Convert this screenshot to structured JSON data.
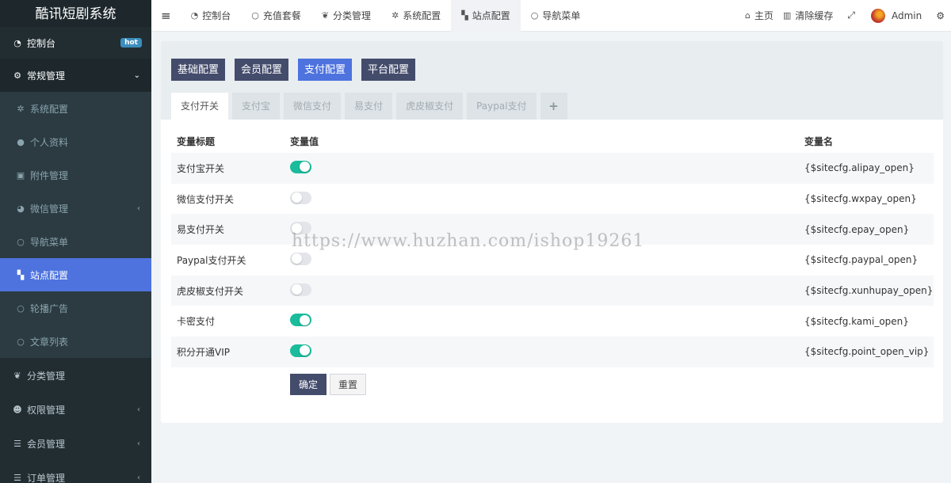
{
  "app": {
    "title": "酷讯短剧系统"
  },
  "sidebar": {
    "dashboard": {
      "label": "控制台",
      "badge": "hot"
    },
    "group_regular": {
      "label": "常规管理"
    },
    "sub_items": [
      {
        "label": "系统配置",
        "icon": "gear-icon"
      },
      {
        "label": "个人资料",
        "icon": "user-icon"
      },
      {
        "label": "附件管理",
        "icon": "file-image-icon"
      },
      {
        "label": "微信管理",
        "icon": "wechat-icon"
      },
      {
        "label": "导航菜单",
        "icon": "circle-icon"
      },
      {
        "label": "站点配置",
        "icon": "qrcode-icon"
      },
      {
        "label": "轮播广告",
        "icon": "circle-icon"
      },
      {
        "label": "文章列表",
        "icon": "circle-icon"
      }
    ],
    "bottom_items": [
      {
        "label": "分类管理",
        "icon": "leaf-icon"
      },
      {
        "label": "权限管理",
        "icon": "users-icon"
      },
      {
        "label": "会员管理",
        "icon": "list-icon"
      },
      {
        "label": "订单管理",
        "icon": "list-icon"
      }
    ]
  },
  "topnav": {
    "items": [
      {
        "label": "控制台"
      },
      {
        "label": "充值套餐"
      },
      {
        "label": "分类管理"
      },
      {
        "label": "系统配置"
      },
      {
        "label": "站点配置"
      },
      {
        "label": "导航菜单"
      }
    ],
    "home": "主页",
    "clear_cache": "清除缓存",
    "user": "Admin"
  },
  "config_tabs": [
    "基础配置",
    "会员配置",
    "支付配置",
    "平台配置"
  ],
  "sub_tabs": [
    "支付开关",
    "支付宝",
    "微信支付",
    "易支付",
    "虎皮椒支付",
    "Paypal支付"
  ],
  "table": {
    "headers": [
      "变量标题",
      "变量值",
      "变量名"
    ],
    "rows": [
      {
        "title": "支付宝开关",
        "on": true,
        "var": "{$sitecfg.alipay_open}"
      },
      {
        "title": "微信支付开关",
        "on": false,
        "var": "{$sitecfg.wxpay_open}"
      },
      {
        "title": "易支付开关",
        "on": false,
        "var": "{$sitecfg.epay_open}"
      },
      {
        "title": "Paypal支付开关",
        "on": false,
        "var": "{$sitecfg.paypal_open}"
      },
      {
        "title": "虎皮椒支付开关",
        "on": false,
        "var": "{$sitecfg.xunhupay_open}"
      },
      {
        "title": "卡密支付",
        "on": true,
        "var": "{$sitecfg.kami_open}"
      },
      {
        "title": "积分开通VIP",
        "on": true,
        "var": "{$sitecfg.point_open_vip}"
      }
    ]
  },
  "actions": {
    "confirm": "确定",
    "reset": "重置"
  },
  "watermark": "https://www.huzhan.com/ishop19261",
  "colors": {
    "sidebar": "#222d32",
    "accent": "#4e73df",
    "button_dark": "#444c6c",
    "switch_on": "#1abc9c"
  }
}
